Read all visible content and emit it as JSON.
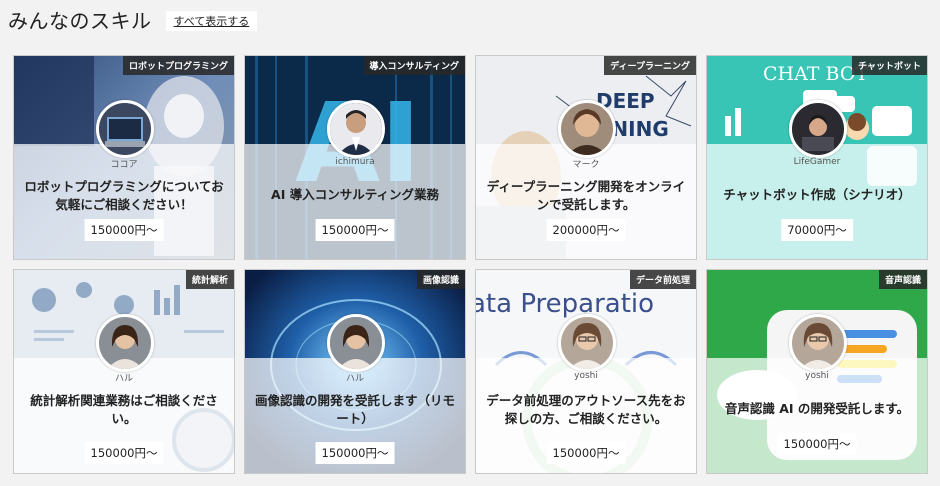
{
  "header": {
    "title": "みんなのスキル",
    "show_all": "すべて表示する"
  },
  "cards": [
    {
      "tag": "ロボットプログラミング",
      "user": "ココア",
      "title": "ロボットプログラミングについてお気軽にご相談ください！",
      "price": "150000円〜"
    },
    {
      "tag": "導入コンサルティング",
      "user": "ichimura",
      "title": "AI 導入コンサルティング業務",
      "price": "150000円〜"
    },
    {
      "tag": "ディープラーニング",
      "user": "マーク",
      "title": "ディープラーニング開発をオンラインで受託します。",
      "price": "200000円〜"
    },
    {
      "tag": "チャットボット",
      "user": "LifeGamer",
      "title": "チャットボット作成（シナリオ）",
      "price": "70000円〜"
    },
    {
      "tag": "統計解析",
      "user": "ハル",
      "title": "統計解析関連業務はご相談ください。",
      "price": "150000円〜"
    },
    {
      "tag": "画像認識",
      "user": "ハル",
      "title": "画像認識の開発を受託します（リモート）",
      "price": "150000円〜"
    },
    {
      "tag": "データ前処理",
      "user": "yoshi",
      "title": "データ前処理のアウトソース先をお探しの方、ご相談ください。",
      "price": "150000円〜"
    },
    {
      "tag": "音声認識",
      "user": "yoshi",
      "title": "音声認識 AI の開発受託します。",
      "price": "150000円〜"
    }
  ],
  "bg_text": {
    "ai": "AI",
    "deep": "DEEP",
    "rning": "RNING",
    "chatbot": "CHAT BOT",
    "dataprep": "ata Preparatio"
  }
}
